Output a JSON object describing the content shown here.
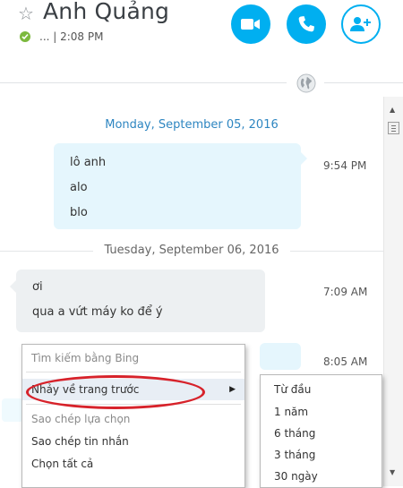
{
  "header": {
    "contact_name": "Anh Quảng",
    "status_text": "... | 2:08 PM",
    "status_color": "#7cb93e",
    "accent_color": "#00aff0",
    "icons": [
      "star-icon",
      "video-call-icon",
      "phone-call-icon",
      "add-person-icon",
      "globe-icon"
    ]
  },
  "chat": {
    "date1": "Monday, September 05, 2016",
    "date2": "Tuesday, September 06, 2016",
    "messages": [
      {
        "lines": [
          "lô anh",
          "alo",
          "blo"
        ],
        "time": "9:54 PM"
      },
      {
        "lines": [
          "ơi",
          "qua a vứt máy ko để ý"
        ],
        "time": "7:09 AM"
      },
      {
        "lines": [],
        "time": "8:05 AM"
      }
    ]
  },
  "context_menu": {
    "items": [
      "Tìm kiếm bằng Bing",
      "Nhảy về trang trước",
      "Sao chép lựa chọn",
      "Sao chép tin nhắn",
      "Chọn tất cả"
    ]
  },
  "submenu": {
    "items": [
      "Từ đầu",
      "1 năm",
      "6 tháng",
      "3 tháng",
      "30 ngày"
    ]
  }
}
